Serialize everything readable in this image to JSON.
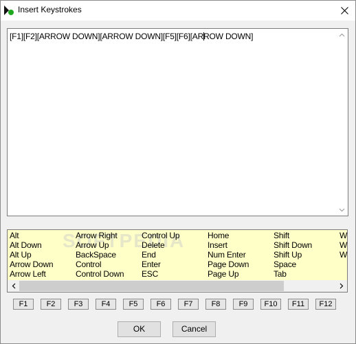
{
  "window": {
    "title": "Insert Keystrokes",
    "icon": "play-circle-icon",
    "close_icon": "close-icon"
  },
  "editor": {
    "text_before_caret": "[F1][F2][ARROW DOWN][ARROW DOWN][F5][F6][AR",
    "text_after_caret": "ROW DOWN]"
  },
  "keylist": {
    "watermark": "SOFTPEDIA",
    "columns": [
      [
        "Alt",
        "Alt Down",
        "Alt Up",
        "Arrow Down",
        "Arrow Left"
      ],
      [
        "Arrow Right",
        "Arrow Up",
        "BackSpace",
        "Control",
        "Control Down"
      ],
      [
        "Control Up",
        "Delete",
        "End",
        "Enter",
        "ESC"
      ],
      [
        "Home",
        "Insert",
        "Num Enter",
        "Page Down",
        "Page Up"
      ],
      [
        "Shift",
        "Shift Down",
        "Shift Up",
        "Space",
        "Tab"
      ],
      [
        "W",
        "W",
        "W",
        "",
        ""
      ]
    ]
  },
  "fkeys": [
    "F1",
    "F2",
    "F3",
    "F4",
    "F5",
    "F6",
    "F7",
    "F8",
    "F9",
    "F10",
    "F11",
    "F12"
  ],
  "buttons": {
    "ok": "OK",
    "cancel": "Cancel"
  },
  "colors": {
    "list_background": "#ffffc8",
    "icon_green": "#1fa81f"
  }
}
